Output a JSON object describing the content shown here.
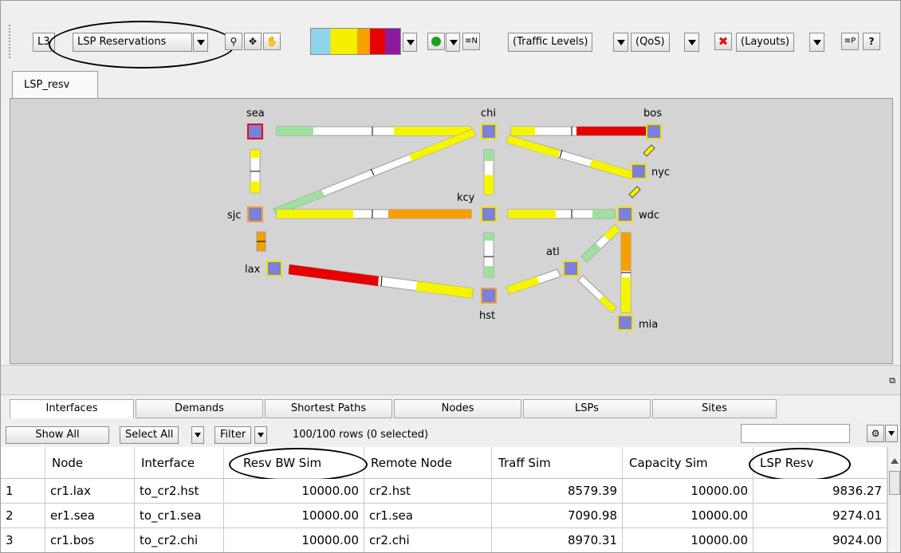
{
  "toolbar": {
    "layer_button": "L3",
    "view_select": "LSP Reservations",
    "traffic_levels": "(Traffic Levels)",
    "qos": "(QoS)",
    "layouts": "(Layouts)",
    "icons": [
      "zoom-icon",
      "fit-view-icon",
      "pan-hand-icon",
      "color-scale-icon",
      "simulate-play-icon",
      "edit-nodes-icon",
      "delete-icon",
      "parameters-icon",
      "help-icon"
    ],
    "color_scale": [
      "#8fd4ea",
      "#f5ef00",
      "#f5ef00",
      "#f7a000",
      "#e60000",
      "#8c1aa0"
    ]
  },
  "doc_tab": {
    "label": "LSP_resv"
  },
  "map": {
    "nodes": [
      {
        "id": "sea",
        "label": "sea"
      },
      {
        "id": "chi",
        "label": "chi"
      },
      {
        "id": "bos",
        "label": "bos"
      },
      {
        "id": "nyc",
        "label": "nyc"
      },
      {
        "id": "kcy",
        "label": "kcy"
      },
      {
        "id": "sjc",
        "label": "sjc"
      },
      {
        "id": "wdc",
        "label": "wdc"
      },
      {
        "id": "atl",
        "label": "atl"
      },
      {
        "id": "lax",
        "label": "lax"
      },
      {
        "id": "hst",
        "label": "hst"
      },
      {
        "id": "mia",
        "label": "mia"
      }
    ],
    "colors": {
      "green": "#9fe09f",
      "yellow": "#f5f500",
      "orange": "#f5a000",
      "red": "#e60000",
      "node_fill": "#7b80d8",
      "node_border_yellow": "#f0e000",
      "node_border_orange": "#f0a030",
      "node_border_red": "#e01010"
    }
  },
  "bottom_tabs": [
    "Interfaces",
    "Demands",
    "Shortest Paths",
    "Nodes",
    "LSPs",
    "Sites"
  ],
  "filter_bar": {
    "show_all": "Show All",
    "select_all": "Select All",
    "filter": "Filter",
    "row_count": "100/100 rows (0 selected)"
  },
  "table": {
    "columns": [
      "Node",
      "Interface",
      "Resv BW Sim",
      "Remote Node",
      "Traff Sim",
      "Capacity Sim",
      "LSP Resv"
    ],
    "rows": [
      {
        "n": "1",
        "node": "cr1.lax",
        "interface": "to_cr2.hst",
        "resv": "10000.00",
        "remote": "cr2.hst",
        "traff": "8579.39",
        "capacity": "10000.00",
        "lsp": "9836.27"
      },
      {
        "n": "2",
        "node": "er1.sea",
        "interface": "to_cr1.sea",
        "resv": "10000.00",
        "remote": "cr1.sea",
        "traff": "7090.98",
        "capacity": "10000.00",
        "lsp": "9274.01"
      },
      {
        "n": "3",
        "node": "cr1.bos",
        "interface": "to_cr2.chi",
        "resv": "10000.00",
        "remote": "cr2.chi",
        "traff": "8970.31",
        "capacity": "10000.00",
        "lsp": "9024.00"
      }
    ]
  }
}
